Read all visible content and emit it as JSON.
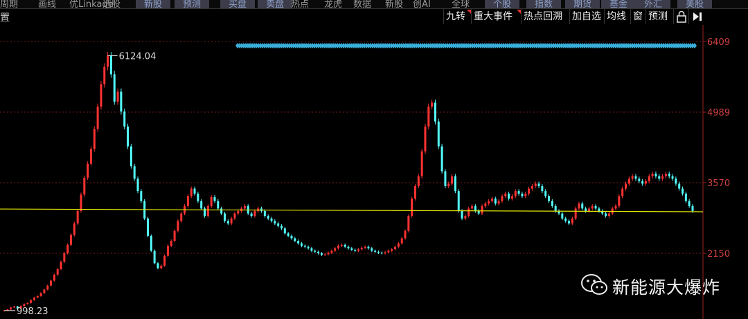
{
  "topbar": {
    "tabs": [
      {
        "label": "周期",
        "style": "plain"
      },
      {
        "label": "画线",
        "style": "plain"
      },
      {
        "label": "优Linkage",
        "style": "plain"
      },
      {
        "label": "选股",
        "style": "plain"
      },
      {
        "label": "新股",
        "style": "button"
      },
      {
        "label": "预测",
        "style": "button"
      },
      {
        "label": "买盘",
        "style": "button"
      },
      {
        "label": "卖盘",
        "style": "button"
      },
      {
        "label": "热点",
        "style": "plain"
      },
      {
        "label": "龙虎",
        "style": "plain"
      },
      {
        "label": "数据",
        "style": "plain"
      },
      {
        "label": "新股",
        "style": "plain"
      },
      {
        "label": "创AI",
        "style": "plain"
      },
      {
        "label": "全球",
        "style": "plain"
      },
      {
        "label": "个股",
        "style": "button"
      },
      {
        "label": "指数",
        "style": "button"
      },
      {
        "label": "期货",
        "style": "button"
      },
      {
        "label": "基金",
        "style": "button"
      },
      {
        "label": "外汇",
        "style": "button"
      },
      {
        "label": "美股",
        "style": "button"
      }
    ]
  },
  "toolbar": {
    "settings_label": "置",
    "buttons": [
      {
        "label": "九转",
        "flag": true
      },
      {
        "label": "重大事件",
        "flag": true
      },
      {
        "label": "热点回溯",
        "flag": false
      },
      {
        "label": "加自选",
        "flag": false
      },
      {
        "label": "均线",
        "flag": false
      },
      {
        "label": "窗",
        "flag": false
      },
      {
        "label": "预测",
        "flag": false
      }
    ],
    "lock_icon": "lock-icon",
    "next_icon": "next-icon"
  },
  "colors": {
    "up": "#ff3232",
    "down": "#54fcfc",
    "ma": "#e6e600",
    "grid": "#7a1a1a",
    "axis_text": "#d04040",
    "event_band": "#3aaed8"
  },
  "chart_data": {
    "type": "line",
    "title": "",
    "xlabel": "",
    "ylabel": "",
    "ylim": [
      998.23,
      6124.04
    ],
    "y_ticks": [
      6409,
      4989,
      3570,
      2150
    ],
    "y_tick_labels": [
      "6409",
      "4989",
      "3570",
      "2150"
    ],
    "grid": true,
    "annotations": [
      {
        "label": "6124.04",
        "kind": "high",
        "value": 6124.04
      },
      {
        "label": "998.23",
        "kind": "low",
        "value": 998.23
      }
    ],
    "moving_average": {
      "value_start": 3040,
      "value_end": 2985
    },
    "series": [
      {
        "values": [
          998,
          1020,
          1060,
          1080,
          1040,
          1090,
          1130,
          1150,
          1210,
          1260,
          1290,
          1350,
          1420,
          1500,
          1600,
          1720,
          1830,
          1980,
          2150,
          2320,
          2520,
          2750,
          3000,
          3330,
          3670,
          3950,
          4250,
          4650,
          5100,
          5550,
          5900,
          6124,
          5750,
          5200,
          5400,
          5000,
          4700,
          4300,
          3900,
          3650,
          3400,
          3200,
          2850,
          2500,
          2200,
          1950,
          1850,
          1900,
          2100,
          2300,
          2400,
          2600,
          2800,
          2950,
          3100,
          3300,
          3450,
          3350,
          3200,
          3050,
          2900,
          3100,
          3280,
          3200,
          3050,
          2950,
          2800,
          2750,
          2850,
          2950,
          3000,
          3050,
          3100,
          2950,
          2900,
          3000,
          3050,
          3000,
          2900,
          2850,
          2800,
          2750,
          2700,
          2650,
          2550,
          2500,
          2450,
          2400,
          2350,
          2300,
          2280,
          2250,
          2200,
          2180,
          2150,
          2120,
          2130,
          2160,
          2200,
          2250,
          2300,
          2320,
          2280,
          2250,
          2220,
          2200,
          2230,
          2260,
          2280,
          2250,
          2200,
          2180,
          2160,
          2150,
          2170,
          2200,
          2230,
          2280,
          2350,
          2450,
          2600,
          2900,
          3250,
          3500,
          3700,
          4200,
          4700,
          5100,
          5180,
          4800,
          4300,
          3800,
          3500,
          3550,
          3700,
          3400,
          3000,
          2850,
          2900,
          3050,
          3100,
          3000,
          2950,
          3100,
          3150,
          3200,
          3250,
          3150,
          3200,
          3300,
          3350,
          3250,
          3300,
          3400,
          3350,
          3300,
          3350,
          3450,
          3500,
          3550,
          3500,
          3400,
          3300,
          3200,
          3100,
          3000,
          2950,
          2850,
          2800,
          2750,
          2850,
          3050,
          3150,
          3050,
          3000,
          3050,
          3100,
          3050,
          3000,
          2950,
          2900,
          2950,
          3050,
          3100,
          3300,
          3450,
          3550,
          3650,
          3700,
          3650,
          3600,
          3550,
          3600,
          3700,
          3750,
          3700,
          3650,
          3700,
          3750,
          3700,
          3650,
          3550,
          3450,
          3350,
          3200,
          3100,
          3000
        ]
      }
    ]
  },
  "watermark": {
    "text": "新能源大爆炸",
    "icon": "wechat-icon"
  }
}
